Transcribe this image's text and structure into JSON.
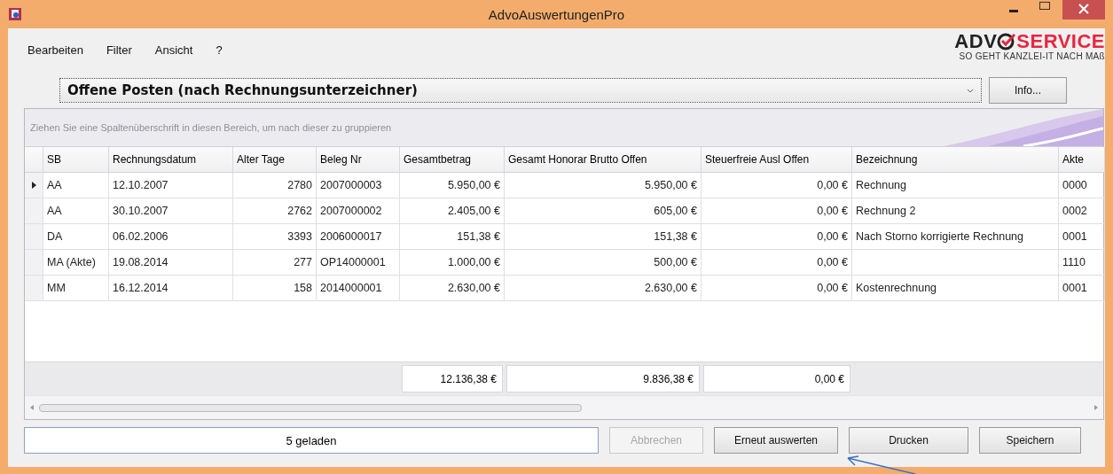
{
  "window": {
    "title": "AdvoAuswertungenPro"
  },
  "menu": [
    {
      "label": "Bearbeiten"
    },
    {
      "label": "Filter"
    },
    {
      "label": "Ansicht"
    },
    {
      "label": "?"
    }
  ],
  "logo": {
    "brand_left": "ADV",
    "brand_right": "SERVICE",
    "tagline": "SO GEHT KANZLEI-IT NACH MAß"
  },
  "report_select": {
    "value": "Offene Posten (nach Rechnungsunterzeichner)"
  },
  "info_button": {
    "label": "Info..."
  },
  "group_panel": {
    "hint": "Ziehen Sie eine Spaltenüberschrift in diesen Bereich, um nach dieser zu gruppieren"
  },
  "table": {
    "columns": [
      {
        "label": "SB"
      },
      {
        "label": "Rechnungsdatum"
      },
      {
        "label": "Alter Tage"
      },
      {
        "label": "Beleg Nr"
      },
      {
        "label": "Gesamtbetrag",
        "total": "12.136,38 €"
      },
      {
        "label": "Gesamt Honorar Brutto Offen",
        "total": "9.836,38 €"
      },
      {
        "label": "Steuerfreie Ausl Offen",
        "total": "0,00 €"
      },
      {
        "label": "Bezeichnung"
      },
      {
        "label": "Akte"
      }
    ],
    "rows": [
      {
        "selected": true,
        "cells": [
          "AA",
          "12.10.2007",
          "2780",
          "2007000003",
          "5.950,00 €",
          "5.950,00 €",
          "0,00 €",
          "Rechnung",
          "0000"
        ]
      },
      {
        "selected": false,
        "cells": [
          "AA",
          "30.10.2007",
          "2762",
          "2007000002",
          "2.405,00 €",
          "605,00 €",
          "0,00 €",
          "Rechnung 2",
          "0002"
        ]
      },
      {
        "selected": false,
        "cells": [
          "DA",
          "06.02.2006",
          "3393",
          "2006000017",
          "151,38 €",
          "151,38 €",
          "0,00 €",
          "Nach Storno korrigierte Rechnung",
          "0001"
        ]
      },
      {
        "selected": false,
        "cells": [
          "MA (Akte)",
          "19.08.2014",
          "277",
          "OP14000001",
          "1.000,00 €",
          "500,00 €",
          "0,00 €",
          null,
          "1110"
        ]
      },
      {
        "selected": false,
        "cells": [
          "MM",
          "16.12.2014",
          "158",
          "2014000001",
          "2.630,00 €",
          "2.630,00 €",
          "0,00 €",
          "Kostenrechnung",
          "0001"
        ]
      }
    ]
  },
  "status": {
    "text": "5 geladen"
  },
  "buttons": [
    {
      "label": "Abbrechen",
      "disabled": true
    },
    {
      "label": "Erneut auswerten",
      "disabled": false
    },
    {
      "label": "Drucken",
      "disabled": false
    },
    {
      "label": "Speichern",
      "disabled": false
    }
  ]
}
